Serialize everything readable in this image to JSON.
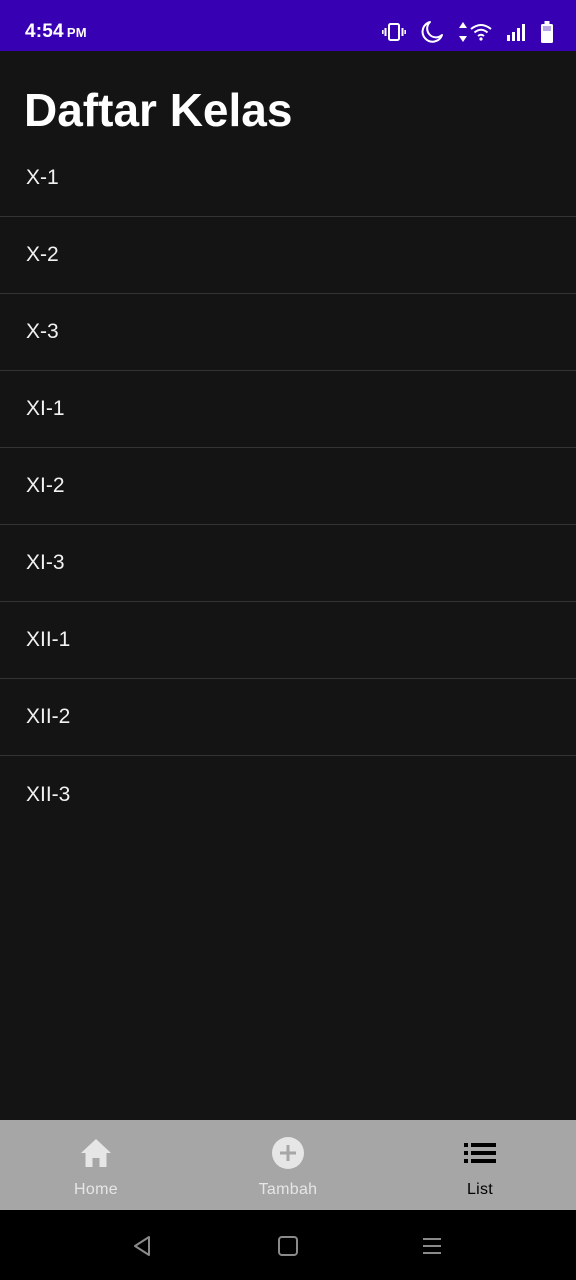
{
  "status_bar": {
    "time": "4:54",
    "ampm": "PM",
    "background_color": "#3700b3",
    "icons": [
      "vibrate-icon",
      "moon-icon",
      "data-arrows-icon",
      "wifi-icon",
      "signal-icon",
      "battery-icon"
    ]
  },
  "page": {
    "title": "Daftar Kelas"
  },
  "class_list": [
    {
      "label": "X-1"
    },
    {
      "label": "X-2"
    },
    {
      "label": "X-3"
    },
    {
      "label": "XI-1"
    },
    {
      "label": "XI-2"
    },
    {
      "label": "XI-3"
    },
    {
      "label": "XII-1"
    },
    {
      "label": "XII-2"
    },
    {
      "label": "XII-3"
    }
  ],
  "bottom_nav": {
    "active": "List",
    "items": [
      {
        "label": "Home",
        "icon": "home-icon"
      },
      {
        "label": "Tambah",
        "icon": "add-circle-icon"
      },
      {
        "label": "List",
        "icon": "list-icon"
      }
    ]
  },
  "system_nav": {
    "buttons": [
      "back-icon",
      "home-square-icon",
      "menu-icon"
    ]
  }
}
